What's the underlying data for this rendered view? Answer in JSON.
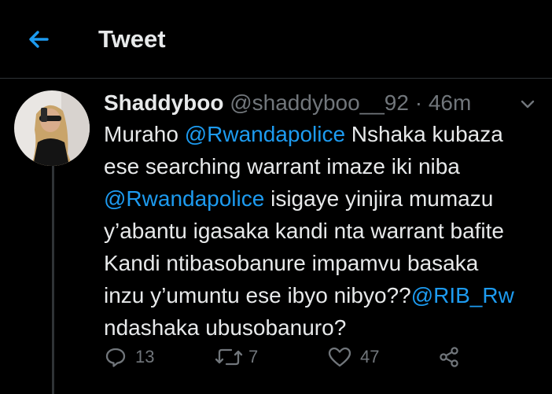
{
  "header": {
    "title": "Tweet"
  },
  "tweet": {
    "display_name": "Shaddyboo",
    "handle": "@shaddyboo__92",
    "separator": " · ",
    "time": "46m",
    "body": {
      "l1_a": "Muraho ",
      "l1_m": "@Rwandapolice",
      "l1_b": " Nshaka kubaza",
      "l2": "ese searching warrant imaze iki niba",
      "l3_m": "@Rwandapolice",
      "l3_b": " isigaye yinjira mumazu",
      "l4": "y’abantu igasaka kandi nta warrant bafite",
      "l5": "Kandi ntibasobanure impamvu basaka",
      "l6_a": "inzu y’umuntu ese ibyo nibyo??",
      "l6_m": "@RIB_Rw",
      "l7": "ndashaka ubusobanuro?"
    },
    "actions": {
      "replies": "13",
      "retweets": "7",
      "likes": "47"
    }
  },
  "colors": {
    "background": "#000000",
    "text": "#e7e9ea",
    "muted": "#71767b",
    "accent": "#1d9bf0",
    "divider": "#2f3336"
  },
  "icons": [
    "back-arrow-icon",
    "chevron-down-icon",
    "reply-icon",
    "retweet-icon",
    "like-icon",
    "share-icon"
  ]
}
